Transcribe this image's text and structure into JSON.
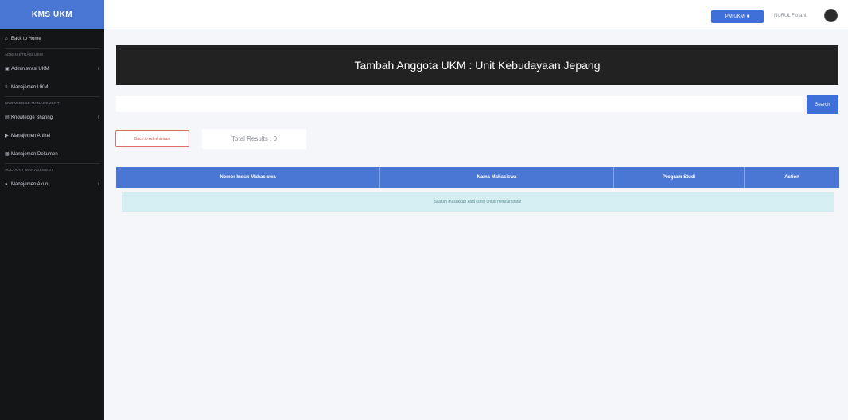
{
  "brand": "KMS UKM",
  "sidebar": {
    "items": [
      {
        "icon": "home-icon",
        "label": "Back to Home",
        "has_chevron": false
      },
      {
        "heading": "ADMINISTRASI UKM"
      },
      {
        "icon": "folder-icon",
        "label": "Administrasi UKM",
        "has_chevron": true
      },
      {
        "icon": "list-icon",
        "label": "Manajemen UKM",
        "has_chevron": false
      },
      {
        "heading": "KNOWLEDGE MANAGEMENT"
      },
      {
        "icon": "book-icon",
        "label": "Knowledge Sharing",
        "has_chevron": true
      },
      {
        "icon": "video-icon",
        "label": "Manajemen Artikel",
        "has_chevron": false
      },
      {
        "icon": "calendar-icon",
        "label": "Manajemen Dokumen",
        "has_chevron": false
      },
      {
        "heading": "ACCOUNT MANAGEMENT"
      },
      {
        "icon": "user-icon",
        "label": "Manajemen Akun",
        "has_chevron": true
      }
    ]
  },
  "topbar": {
    "pm_button": "PM UKM",
    "user_name": "NURUL Fitriani"
  },
  "page": {
    "title": "Tambah Anggota UKM : Unit Kebudayaan Jepang",
    "search_placeholder": "",
    "search_button": "Search",
    "back_button": "Back to Administrasi",
    "total_results": "Total Results : 0"
  },
  "table": {
    "columns": [
      "Nomor Induk Mahasiswa",
      "Nama Mahasiswa",
      "Program Studi",
      "Action"
    ],
    "empty_message": "Silakan masukkan kata kunci untuk mencari data!"
  }
}
